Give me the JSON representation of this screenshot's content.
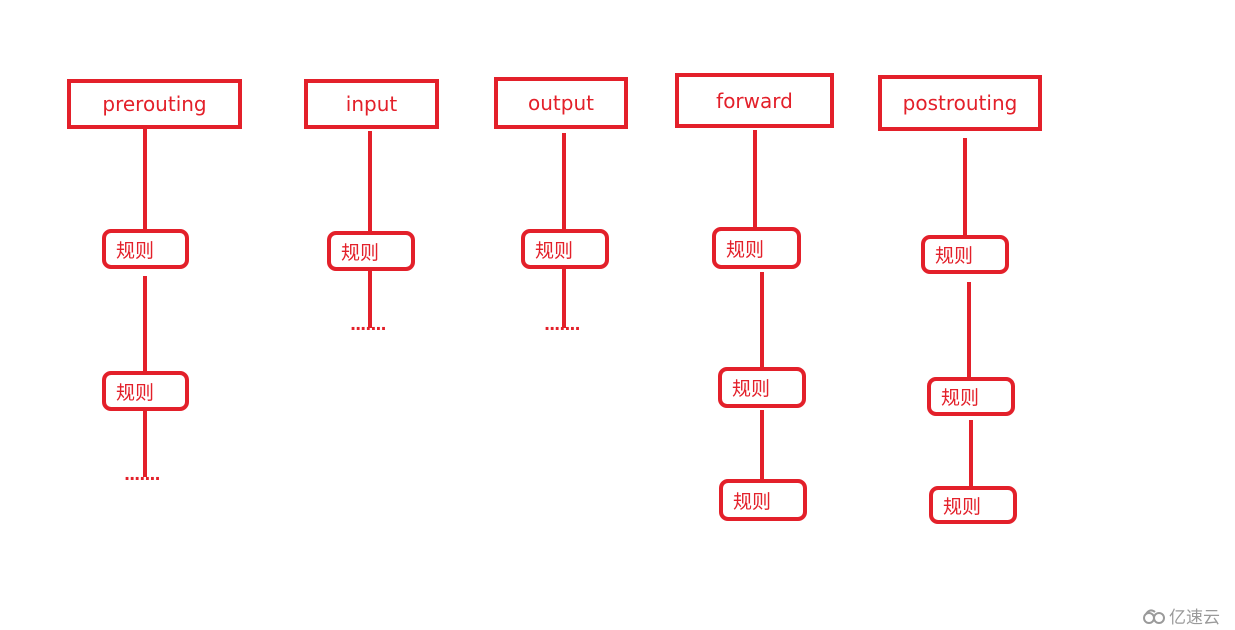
{
  "chains": [
    {
      "label": "prerouting"
    },
    {
      "label": "input"
    },
    {
      "label": "output"
    },
    {
      "label": "forward"
    },
    {
      "label": "postrouting"
    }
  ],
  "rule_label": "规则",
  "continuation": ".......",
  "accent_color": "#e3202a",
  "watermark": {
    "text": "亿速云",
    "icon": "cloud-logo-icon"
  }
}
